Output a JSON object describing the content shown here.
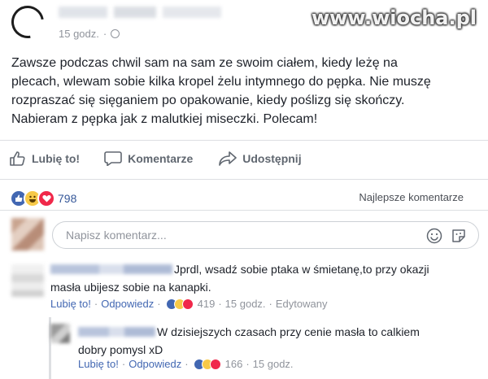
{
  "post": {
    "timestamp": "15 godz.",
    "privacy_icon": "globe-icon",
    "lines": [
      "Zawsze podczas chwil sam na sam ze swoim ciałem, kiedy leżę na",
      "plecach, wlewam sobie kilka kropel żelu intymnego do pępka. Nie muszę",
      "rozpraszać się sięganiem po opakowanie, kiedy poślizg się skończy.",
      "Nabieram z pępka jak z malutkiej miseczki. Polecam!"
    ]
  },
  "watermark": "www.wiocha.pl",
  "actions": {
    "like": "Lubię to!",
    "comment": "Komentarze",
    "share": "Udostępnij"
  },
  "reactions": {
    "count": "798",
    "icons": [
      "like",
      "haha",
      "love"
    ],
    "colors": {
      "like": "#4267b2",
      "haha": "#f7c948",
      "love": "#f0284a"
    },
    "sort_label": "Najlepsze komentarze"
  },
  "composer": {
    "placeholder": "Napisz komentarz..."
  },
  "comments": [
    {
      "text_lines": [
        "Jprdl, wsadź sobie ptaka w śmietanę,to przy okazji",
        "masła ubijesz sobie na kanapki."
      ],
      "like_label": "Lubię to!",
      "reply_label": "Odpowiedz",
      "reaction_count": "419",
      "time": "15 godz.",
      "edited": "Edytowany"
    },
    {
      "text_lines": [
        "W dzisiejszych czasach przy cenie masła to calkiem",
        "dobry pomysl xD"
      ],
      "like_label": "Lubię to!",
      "reply_label": "Odpowiedz",
      "reaction_count": "166",
      "time": "15 godz."
    }
  ],
  "colors": {
    "link": "#4267b2",
    "meta": "#90949c",
    "action_text": "#606770"
  }
}
